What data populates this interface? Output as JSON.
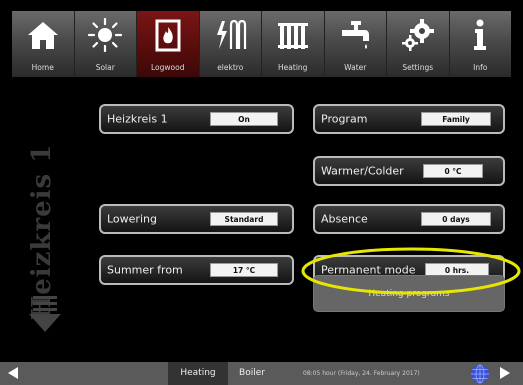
{
  "nav": {
    "items": [
      {
        "label": "Home",
        "icon": "house-icon"
      },
      {
        "label": "Solar",
        "icon": "sun-icon"
      },
      {
        "label": "Logwood",
        "icon": "stove-flame-icon"
      },
      {
        "label": "elektro",
        "icon": "heating-element-icon"
      },
      {
        "label": "Heating",
        "icon": "radiator-icon"
      },
      {
        "label": "Water",
        "icon": "faucet-icon"
      },
      {
        "label": "Settings",
        "icon": "gears-icon"
      },
      {
        "label": "Info",
        "icon": "info-icon"
      }
    ]
  },
  "side_title": "Heizkreis 1",
  "settings": {
    "circuit": {
      "label": "Heizkreis 1",
      "value": "On"
    },
    "program": {
      "label": "Program",
      "value": "Family"
    },
    "warmer_colder": {
      "label": "Warmer/Colder",
      "value": "0 °C"
    },
    "lowering": {
      "label": "Lowering",
      "value": "Standard"
    },
    "absence": {
      "label": "Absence",
      "value": "0 days"
    },
    "summer_from": {
      "label": "Summer from",
      "value": "17 °C"
    },
    "permanent_mode": {
      "label": "Permanent mode",
      "value": "0 hrs."
    },
    "heating_programs": {
      "label": "Heating programs"
    }
  },
  "bottom": {
    "tabs": [
      {
        "label": "Heating"
      },
      {
        "label": "Boiler"
      }
    ],
    "status": "08:05 hour (Friday, 24. February 2017)"
  },
  "colors": {
    "background": "#000000",
    "active_nav": "#5c0d0d",
    "highlight": "#e6e600",
    "value_box": "#f2f2f2"
  }
}
